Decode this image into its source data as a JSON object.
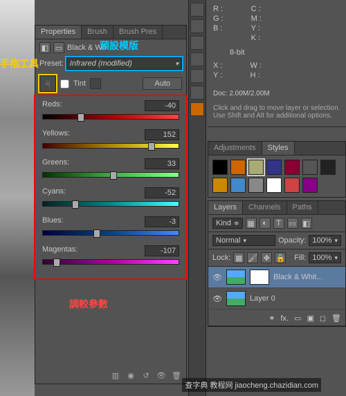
{
  "properties": {
    "tabs": [
      "Properties",
      "Brush",
      "Brush Pres"
    ],
    "title": "Black & Wh",
    "preset_label": "Preset:",
    "preset_value": "Infrared (modified)",
    "tint_label": "Tint",
    "auto_label": "Auto",
    "sliders": [
      {
        "name": "Reds:",
        "value": "-40",
        "grad": "grad-reds",
        "pos": 28
      },
      {
        "name": "Yellows:",
        "value": "152",
        "grad": "grad-yellows",
        "pos": 80
      },
      {
        "name": "Greens:",
        "value": "33",
        "grad": "grad-greens",
        "pos": 52
      },
      {
        "name": "Cyans:",
        "value": "-52",
        "grad": "grad-cyans",
        "pos": 24
      },
      {
        "name": "Blues:",
        "value": "-3",
        "grad": "grad-blues",
        "pos": 40
      },
      {
        "name": "Magentas:",
        "value": "-107",
        "grad": "grad-magentas",
        "pos": 10
      }
    ]
  },
  "info": {
    "rgb": {
      "R": "",
      "G": "",
      "B": ""
    },
    "cmyk": {
      "C": "",
      "M": "",
      "Y": "",
      "K": ""
    },
    "bit": "8-bit",
    "xy": {
      "X": "",
      "Y": ""
    },
    "wh": {
      "W": "",
      "H": ""
    },
    "doc": "Doc: 2.00M/2.00M",
    "hint": "Click and drag to move layer or selection. Use Shift and Alt for additional options."
  },
  "adjustments": {
    "tabs": [
      "Adjustments",
      "Styles"
    ],
    "swatches": [
      "#000",
      "#c60",
      "#aa7",
      "#338",
      "#803",
      "#555",
      "#222",
      "#c80",
      "#48c",
      "#888",
      "#fff",
      "#c44",
      "#808"
    ]
  },
  "layers": {
    "tabs": [
      "Layers",
      "Channels",
      "Paths"
    ],
    "kind": "Kind",
    "blend": "Normal",
    "opacity_label": "Opacity:",
    "opacity": "100%",
    "lock_label": "Lock:",
    "fill_label": "Fill:",
    "fill": "100%",
    "items": [
      {
        "name": "Black & Whit...",
        "active": true,
        "hasMask": true
      },
      {
        "name": "Layer 0",
        "active": false,
        "hasMask": false
      }
    ]
  },
  "annotations": {
    "preset_template": "預設模版",
    "finger_tool": "手指工具",
    "adjust_params": "調較參數"
  },
  "watermark": "查字典   教程网\njiaocheng.chazidian.com"
}
